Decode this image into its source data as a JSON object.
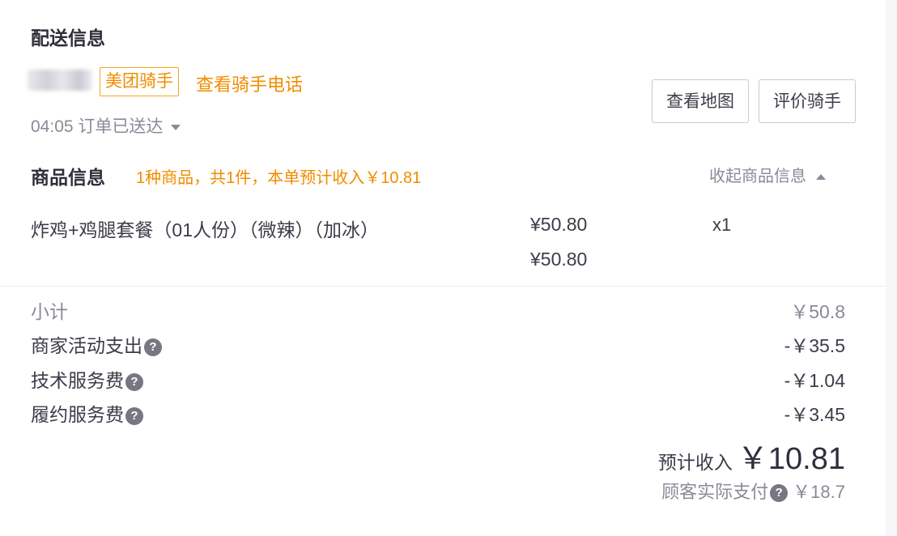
{
  "delivery": {
    "title": "配送信息",
    "rider_badge": "美团骑手",
    "view_phone": "查看骑手电话",
    "status": "04:05 订单已送达",
    "view_map_button": "查看地图",
    "rate_rider_button": "评价骑手"
  },
  "goods": {
    "title": "商品信息",
    "summary": "1种商品，共1件，本单预计收入￥10.81",
    "collapse_label": "收起商品信息",
    "items": [
      {
        "name": "炸鸡+鸡腿套餐（01人份）（微辣）（加冰）",
        "price": "¥50.80",
        "original_price": "¥50.80",
        "qty": "x1"
      }
    ]
  },
  "fees": {
    "subtotal_label": "小计",
    "subtotal_value": "￥50.8",
    "merchant_activity_label": "商家活动支出",
    "merchant_activity_value": "-￥35.5",
    "tech_service_label": "技术服务费",
    "tech_service_value": "-￥1.04",
    "fulfillment_label": "履约服务费",
    "fulfillment_value": "-￥3.45"
  },
  "income": {
    "label": "预计收入",
    "value": "￥10.81",
    "customer_paid_label": "顾客实际支付",
    "customer_paid_value": "￥18.7"
  },
  "icons": {
    "help": "question-circle-icon",
    "dropdown": "caret-down-icon",
    "collapse": "caret-up-icon"
  },
  "colors": {
    "accent": "#f08c00",
    "text": "#3c3c4a",
    "muted": "#8a8a99"
  }
}
